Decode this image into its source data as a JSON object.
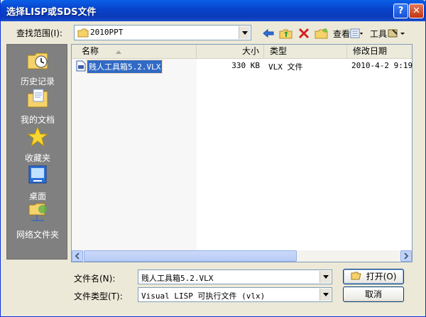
{
  "window": {
    "title": "选择LISP或SDS文件",
    "help_glyph": "?",
    "close_glyph": "✕"
  },
  "lookin": {
    "label": "查找范围(I):",
    "value": "2010PPT"
  },
  "toolbar": {
    "view_label": "查看",
    "tools_label": "工具"
  },
  "places": [
    {
      "label": "历史记录",
      "icon": "history-icon"
    },
    {
      "label": "我的文档",
      "icon": "my-documents-icon"
    },
    {
      "label": "收藏夹",
      "icon": "favorites-icon"
    },
    {
      "label": "桌面",
      "icon": "desktop-icon"
    },
    {
      "label": "网络文件夹",
      "icon": "network-folder-icon"
    }
  ],
  "columns": {
    "name": "名称",
    "size": "大小",
    "type": "类型",
    "modified": "修改日期"
  },
  "files": [
    {
      "name": "贱人工具箱5.2.VLX",
      "size": "330 KB",
      "type": "VLX 文件",
      "modified": "2010-4-2 9:19"
    }
  ],
  "filename": {
    "label": "文件名(N):",
    "value": "贱人工具箱5.2.VLX"
  },
  "filetype": {
    "label": "文件类型(T):",
    "value": "Visual LISP 可执行文件 (vlx)"
  },
  "buttons": {
    "open": "打开(O)",
    "cancel": "取消"
  },
  "colors": {
    "title_bar": "#0842c8",
    "places_bg": "#808080",
    "selection": "#316ac5"
  }
}
